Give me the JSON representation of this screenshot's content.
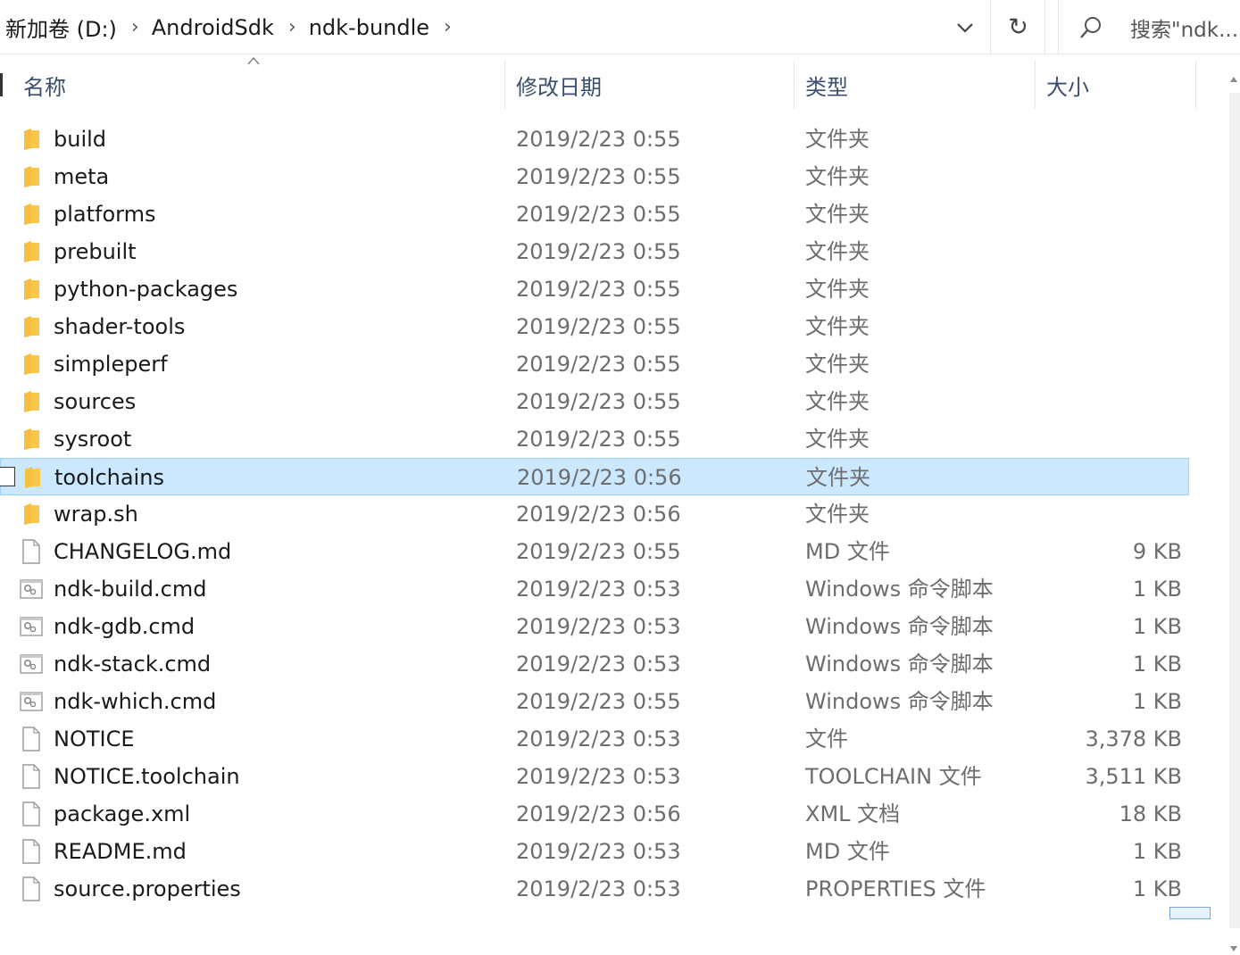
{
  "breadcrumb": {
    "segments": [
      "新加卷 (D:)",
      "AndroidSdk",
      "ndk-bundle"
    ],
    "separator": "›"
  },
  "toolbar": {
    "refresh_glyph": "↻"
  },
  "search": {
    "placeholder": "搜索\"ndk..."
  },
  "columns": {
    "name": "名称",
    "date": "修改日期",
    "type": "类型",
    "size": "大小"
  },
  "files": [
    {
      "name": "build",
      "date": "2019/2/23 0:55",
      "type": "文件夹",
      "size": "",
      "icon": "folder"
    },
    {
      "name": "meta",
      "date": "2019/2/23 0:55",
      "type": "文件夹",
      "size": "",
      "icon": "folder"
    },
    {
      "name": "platforms",
      "date": "2019/2/23 0:55",
      "type": "文件夹",
      "size": "",
      "icon": "folder"
    },
    {
      "name": "prebuilt",
      "date": "2019/2/23 0:55",
      "type": "文件夹",
      "size": "",
      "icon": "folder"
    },
    {
      "name": "python-packages",
      "date": "2019/2/23 0:55",
      "type": "文件夹",
      "size": "",
      "icon": "folder"
    },
    {
      "name": "shader-tools",
      "date": "2019/2/23 0:55",
      "type": "文件夹",
      "size": "",
      "icon": "folder"
    },
    {
      "name": "simpleperf",
      "date": "2019/2/23 0:55",
      "type": "文件夹",
      "size": "",
      "icon": "folder"
    },
    {
      "name": "sources",
      "date": "2019/2/23 0:55",
      "type": "文件夹",
      "size": "",
      "icon": "folder"
    },
    {
      "name": "sysroot",
      "date": "2019/2/23 0:55",
      "type": "文件夹",
      "size": "",
      "icon": "folder"
    },
    {
      "name": "toolchains",
      "date": "2019/2/23 0:56",
      "type": "文件夹",
      "size": "",
      "icon": "folder",
      "selected": true
    },
    {
      "name": "wrap.sh",
      "date": "2019/2/23 0:56",
      "type": "文件夹",
      "size": "",
      "icon": "folder"
    },
    {
      "name": "CHANGELOG.md",
      "date": "2019/2/23 0:55",
      "type": "MD 文件",
      "size": "9 KB",
      "icon": "file"
    },
    {
      "name": "ndk-build.cmd",
      "date": "2019/2/23 0:53",
      "type": "Windows 命令脚本",
      "size": "1 KB",
      "icon": "cmd"
    },
    {
      "name": "ndk-gdb.cmd",
      "date": "2019/2/23 0:53",
      "type": "Windows 命令脚本",
      "size": "1 KB",
      "icon": "cmd"
    },
    {
      "name": "ndk-stack.cmd",
      "date": "2019/2/23 0:53",
      "type": "Windows 命令脚本",
      "size": "1 KB",
      "icon": "cmd"
    },
    {
      "name": "ndk-which.cmd",
      "date": "2019/2/23 0:55",
      "type": "Windows 命令脚本",
      "size": "1 KB",
      "icon": "cmd"
    },
    {
      "name": "NOTICE",
      "date": "2019/2/23 0:53",
      "type": "文件",
      "size": "3,378 KB",
      "icon": "file"
    },
    {
      "name": "NOTICE.toolchain",
      "date": "2019/2/23 0:53",
      "type": "TOOLCHAIN 文件",
      "size": "3,511 KB",
      "icon": "file"
    },
    {
      "name": "package.xml",
      "date": "2019/2/23 0:56",
      "type": "XML 文档",
      "size": "18 KB",
      "icon": "file"
    },
    {
      "name": "README.md",
      "date": "2019/2/23 0:53",
      "type": "MD 文件",
      "size": "1 KB",
      "icon": "file"
    },
    {
      "name": "source.properties",
      "date": "2019/2/23 0:53",
      "type": "PROPERTIES 文件",
      "size": "1 KB",
      "icon": "file"
    }
  ],
  "colors": {
    "selection_bg": "#cce8ff",
    "selection_border": "#99d1ff",
    "folder": "#f8c74a",
    "header_text": "#3a4f6f"
  }
}
